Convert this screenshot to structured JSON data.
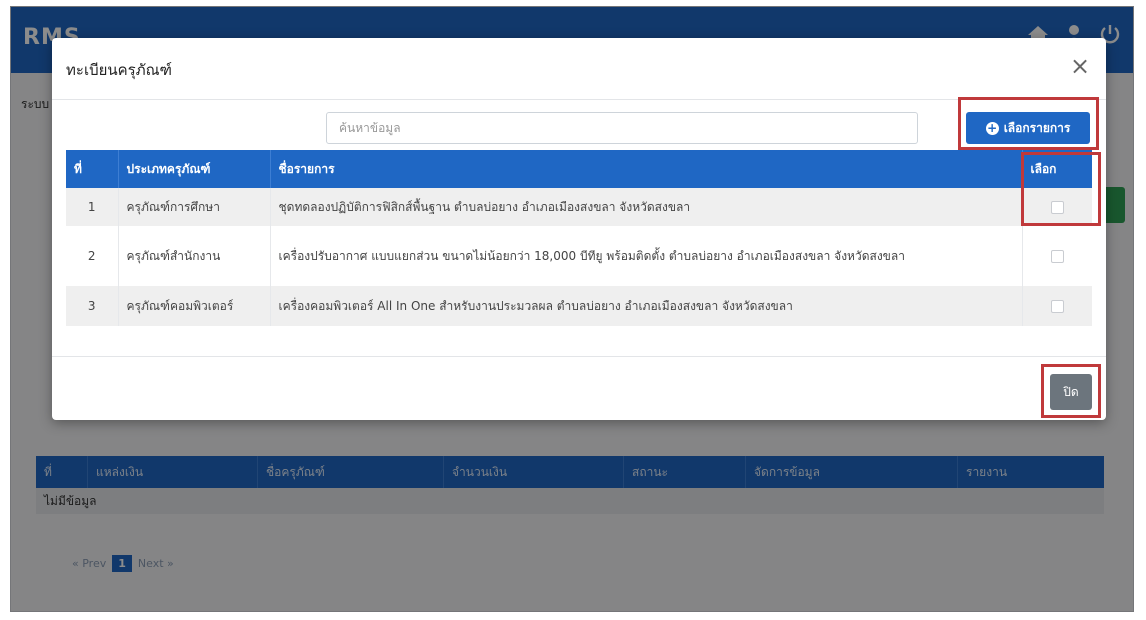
{
  "background": {
    "logo": "RMS",
    "breadcrumb": "ระบบ",
    "table": {
      "headers": [
        "ที่",
        "แหล่งเงิน",
        "ชื่อครุภัณฑ์",
        "จำนวนเงิน",
        "สถานะ",
        "จัดการข้อมูล",
        "รายงาน"
      ],
      "empty_text": "ไม่มีข้อมูล"
    },
    "pager": {
      "prev": "« Prev",
      "current": "1",
      "next": "Next »"
    }
  },
  "modal": {
    "title": "ทะเบียนครุภัณฑ์",
    "close_icon": "×",
    "search": {
      "placeholder": "ค้นหาข้อมูล",
      "value": ""
    },
    "select_button": {
      "icon": "plus-circle-icon",
      "label": "เลือกรายการ"
    },
    "table": {
      "headers": {
        "index": "ที่",
        "type": "ประเภทครุภัณฑ์",
        "name": "ชื่อรายการ",
        "pick": "เลือก"
      },
      "rows": [
        {
          "index": "1",
          "type": "ครุภัณฑ์การศึกษา",
          "name": "ชุดทดลองปฏิบัติการฟิสิกส์พื้นฐาน ตำบลบ่อยาง อำเภอเมืองสงขลา จังหวัดสงขลา",
          "selected": false
        },
        {
          "index": "2",
          "type": "ครุภัณฑ์สำนักงาน",
          "name": "เครื่องปรับอากาศ แบบแยกส่วน ขนาดไม่น้อยกว่า 18,000 บีทียู พร้อมติดตั้ง ตำบลบ่อยาง อำเภอเมืองสงขลา จังหวัดสงขลา",
          "selected": false
        },
        {
          "index": "3",
          "type": "ครุภัณฑ์คอมพิวเตอร์",
          "name": "เครื่องคอมพิวเตอร์ All In One สำหรับงานประมวลผล ตำบลบ่อยาง อำเภอเมืองสงขลา จังหวัดสงขลา",
          "selected": false
        }
      ]
    },
    "close_button": {
      "label": "ปิด"
    }
  },
  "colors": {
    "primary": "#1f67c4",
    "secondary_button": "#6c757d",
    "highlight": "#c0393b"
  }
}
